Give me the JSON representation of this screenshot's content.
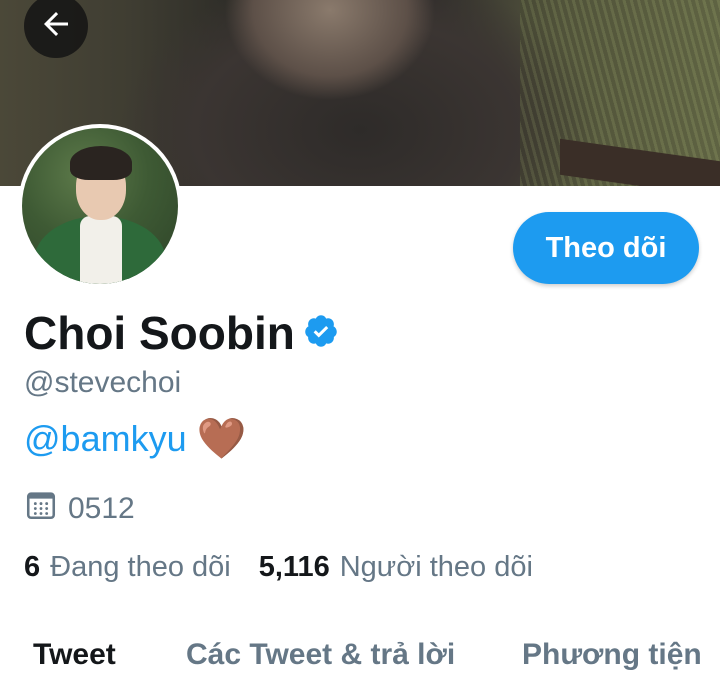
{
  "profile": {
    "display_name": "Choi Soobin",
    "handle": "@stevechoi",
    "bio_link": "@bamkyu",
    "bio_emoji": "🤎",
    "birthday": "0512",
    "following_count": "6",
    "following_label": "Đang theo dõi",
    "followers_count": "5,116",
    "followers_label": "Người theo dõi"
  },
  "actions": {
    "follow_label": "Theo dõi"
  },
  "tabs": [
    {
      "label": "Tweet",
      "active": true
    },
    {
      "label": "Các Tweet & trả lời",
      "active": false
    },
    {
      "label": "Phương tiện",
      "active": false
    }
  ],
  "icons": {
    "back": "arrow-left-icon",
    "verified": "verified-badge-icon",
    "calendar": "calendar-icon"
  },
  "colors": {
    "accent": "#1d9bf0",
    "text_primary": "#14171a",
    "text_secondary": "#657786"
  }
}
